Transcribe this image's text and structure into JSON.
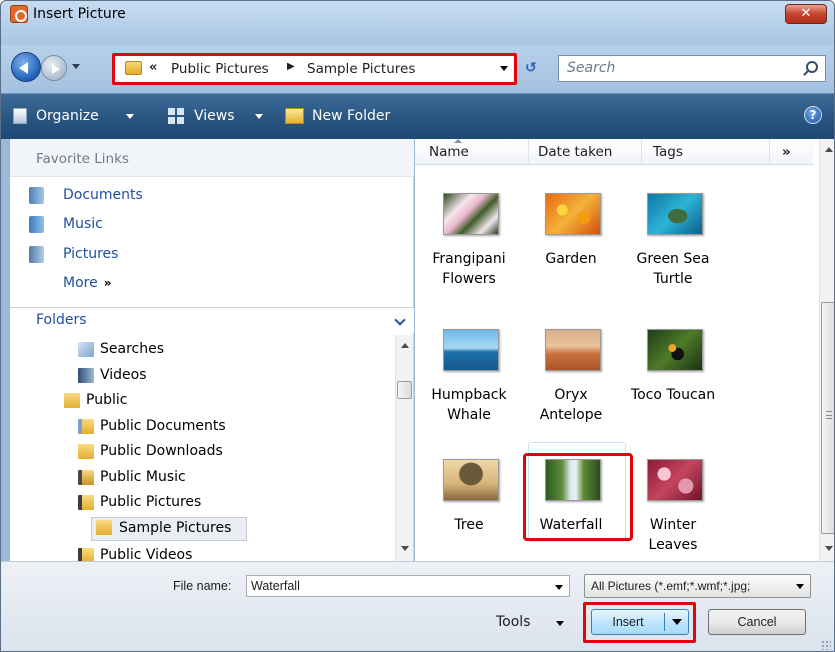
{
  "window": {
    "title": "Insert Picture",
    "close_label": "✕"
  },
  "nav": {
    "address": {
      "chevrons": "«",
      "crumbs": [
        "Public Pictures",
        "Sample Pictures"
      ],
      "separator": "▶"
    },
    "search_placeholder": "Search"
  },
  "toolbar": {
    "organize": "Organize",
    "views": "Views",
    "new_folder": "New Folder",
    "help": "?"
  },
  "favorites": {
    "title": "Favorite Links",
    "items": [
      {
        "label": "Documents",
        "icon": "documents-icon"
      },
      {
        "label": "Music",
        "icon": "music-icon"
      },
      {
        "label": "Pictures",
        "icon": "pictures-icon"
      }
    ],
    "more": "More",
    "more_chevron": "»"
  },
  "folders": {
    "title": "Folders",
    "tree": [
      {
        "label": "Searches",
        "icon": "search-folder-icon"
      },
      {
        "label": "Videos",
        "icon": "videos-icon"
      },
      {
        "label": "Public",
        "icon": "folder-icon"
      },
      {
        "label": "Public Documents",
        "icon": "documents-folder-icon"
      },
      {
        "label": "Public Downloads",
        "icon": "folder-icon"
      },
      {
        "label": "Public Music",
        "icon": "music-folder-icon"
      },
      {
        "label": "Public Pictures",
        "icon": "pictures-folder-icon"
      },
      {
        "label": "Sample Pictures",
        "icon": "folder-icon",
        "selected": true
      },
      {
        "label": "Public Videos",
        "icon": "videos-folder-icon"
      }
    ]
  },
  "columns": {
    "name": "Name",
    "date_taken": "Date taken",
    "tags": "Tags",
    "more": "»"
  },
  "files": [
    {
      "line1": "Frangipani",
      "line2": "Flowers"
    },
    {
      "line1": "Garden",
      "line2": ""
    },
    {
      "line1": "Green Sea",
      "line2": "Turtle"
    },
    {
      "line1": "Humpback",
      "line2": "Whale"
    },
    {
      "line1": "Oryx",
      "line2": "Antelope"
    },
    {
      "line1": "Toco Toucan",
      "line2": ""
    },
    {
      "line1": "Tree",
      "line2": ""
    },
    {
      "line1": "Waterfall",
      "line2": "",
      "selected": true
    },
    {
      "line1": "Winter",
      "line2": "Leaves"
    }
  ],
  "footer": {
    "file_name_label": "File name:",
    "file_name_value": "Waterfall",
    "filter": "All Pictures (*.emf;*.wmf;*.jpg;",
    "tools": "Tools",
    "insert": "Insert",
    "cancel": "Cancel"
  },
  "colors": {
    "highlight": "#e0060b",
    "toolbar": "#2a5682",
    "link": "#1e4fa1"
  }
}
